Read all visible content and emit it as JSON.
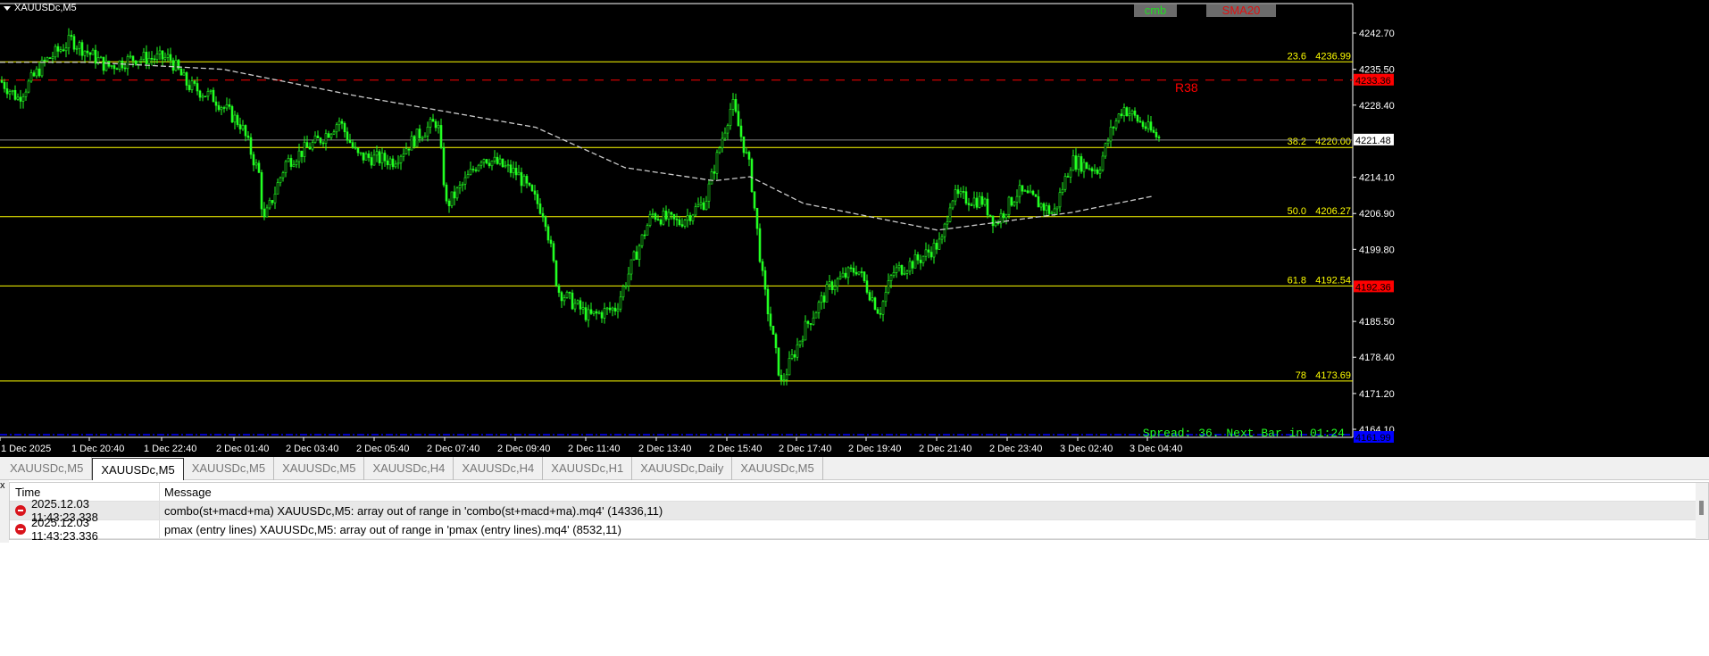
{
  "chart": {
    "title": "XAUUSDc,M5",
    "buttons": [
      {
        "label": "cmb",
        "color": "#22dd22"
      },
      {
        "label": "SMA20",
        "color": "#e01010"
      }
    ],
    "spread_text": "Spread: 36. Next Bar in 01:24",
    "r38_label": "R38"
  },
  "chart_data": {
    "type": "candlestick",
    "symbol": "XAUUSDc",
    "timeframe": "M5",
    "ylim": [
      4161,
      4249
    ],
    "y_ticks": [
      "4242.70",
      "4235.50",
      "4228.40",
      "4214.10",
      "4206.90",
      "4199.80",
      "4185.50",
      "4178.40",
      "4171.20",
      "4164.10"
    ],
    "x_ticks": [
      "1 Dec 2025",
      "1 Dec 20:40",
      "1 Dec 22:40",
      "2 Dec 01:40",
      "2 Dec 03:40",
      "2 Dec 05:40",
      "2 Dec 07:40",
      "2 Dec 09:40",
      "2 Dec 11:40",
      "2 Dec 13:40",
      "2 Dec 15:40",
      "2 Dec 17:40",
      "2 Dec 19:40",
      "2 Dec 21:40",
      "2 Dec 23:40",
      "3 Dec 02:40",
      "3 Dec 04:40"
    ],
    "price_path": [
      [
        0,
        4233.3
      ],
      [
        20,
        4229.8
      ],
      [
        50,
        4236.9
      ],
      [
        80,
        4241.3
      ],
      [
        120,
        4236
      ],
      [
        150,
        4237.7
      ],
      [
        190,
        4237.7
      ],
      [
        210,
        4232.4
      ],
      [
        240,
        4229.8
      ],
      [
        270,
        4224.5
      ],
      [
        290,
        4214.7
      ],
      [
        295,
        4205
      ],
      [
        320,
        4217
      ],
      [
        360,
        4221.8
      ],
      [
        380,
        4225.3
      ],
      [
        400,
        4218.3
      ],
      [
        440,
        4217.4
      ],
      [
        470,
        4222.7
      ],
      [
        490,
        4225.3
      ],
      [
        500,
        4208.5
      ],
      [
        520,
        4213
      ],
      [
        540,
        4218.3
      ],
      [
        580,
        4214.7
      ],
      [
        610,
        4206.8
      ],
      [
        625,
        4191.7
      ],
      [
        660,
        4186.4
      ],
      [
        690,
        4188.2
      ],
      [
        710,
        4197.9
      ],
      [
        730,
        4206.8
      ],
      [
        760,
        4205
      ],
      [
        790,
        4209.4
      ],
      [
        810,
        4222.7
      ],
      [
        820,
        4228.9
      ],
      [
        840,
        4215.6
      ],
      [
        855,
        4192.6
      ],
      [
        875,
        4173.1
      ],
      [
        900,
        4183.7
      ],
      [
        930,
        4192.6
      ],
      [
        960,
        4196.1
      ],
      [
        985,
        4187.3
      ],
      [
        1000,
        4195.2
      ],
      [
        1030,
        4197.9
      ],
      [
        1055,
        4201.4
      ],
      [
        1065,
        4210.3
      ],
      [
        1100,
        4209.4
      ],
      [
        1115,
        4205
      ],
      [
        1140,
        4211.2
      ],
      [
        1160,
        4209.4
      ],
      [
        1180,
        4206.8
      ],
      [
        1200,
        4217.4
      ],
      [
        1230,
        4215.6
      ],
      [
        1245,
        4223.6
      ],
      [
        1258,
        4228
      ],
      [
        1280,
        4224.5
      ],
      [
        1298,
        4221.8
      ]
    ],
    "sma_path": [
      [
        0,
        4236.9
      ],
      [
        100,
        4236.9
      ],
      [
        250,
        4235.5
      ],
      [
        400,
        4230.2
      ],
      [
        600,
        4224
      ],
      [
        700,
        4216
      ],
      [
        800,
        4213.4
      ],
      [
        840,
        4214.2
      ],
      [
        900,
        4208.9
      ],
      [
        1050,
        4203.6
      ],
      [
        1200,
        4207.1
      ],
      [
        1290,
        4210.3
      ]
    ],
    "fibo_levels": [
      {
        "level": "23.6",
        "price": "4236.99"
      },
      {
        "level": "38.2",
        "price": "4220.00"
      },
      {
        "level": "50.0",
        "price": "4206.27"
      },
      {
        "level": "61.8",
        "price": "4192.54"
      },
      {
        "level": "78",
        "price": "4173.69"
      }
    ],
    "price_tags": [
      {
        "price": "4233.36",
        "bg": "#ff0000",
        "fg": "#000000"
      },
      {
        "price": "4221.48",
        "bg": "#ffffff",
        "fg": "#000000"
      },
      {
        "price": "4192.36",
        "bg": "#ff0000",
        "fg": "#000000"
      },
      {
        "price": "4161.99",
        "bg": "#0000ff",
        "fg": "#000000"
      }
    ],
    "colors": {
      "candle": "#22ff22",
      "fibo": "#ffff00",
      "r38": "#ff0000",
      "sma": "#cccccc",
      "bid": "#888888",
      "blue": "#0000ff"
    }
  },
  "tabs": [
    "XAUUSDc,M5",
    "XAUUSDc,M5",
    "XAUUSDc,M5",
    "XAUUSDc,M5",
    "XAUUSDc,H4",
    "XAUUSDc,H4",
    "XAUUSDc,H1",
    "XAUUSDc,Daily",
    "XAUUSDc,M5"
  ],
  "active_tab": 1,
  "log": {
    "close": "x",
    "headers": [
      "Time",
      "Message"
    ],
    "rows": [
      {
        "time": "2025.12.03 11:43:23.338",
        "message": "combo(st+macd+ma) XAUUSDc,M5: array out of range in 'combo(st+macd+ma).mq4' (14336,11)"
      },
      {
        "time": "2025.12.03 11:43:23.336",
        "message": "pmax (entry lines) XAUUSDc,M5: array out of range in 'pmax (entry lines).mq4' (8532,11)"
      }
    ]
  }
}
